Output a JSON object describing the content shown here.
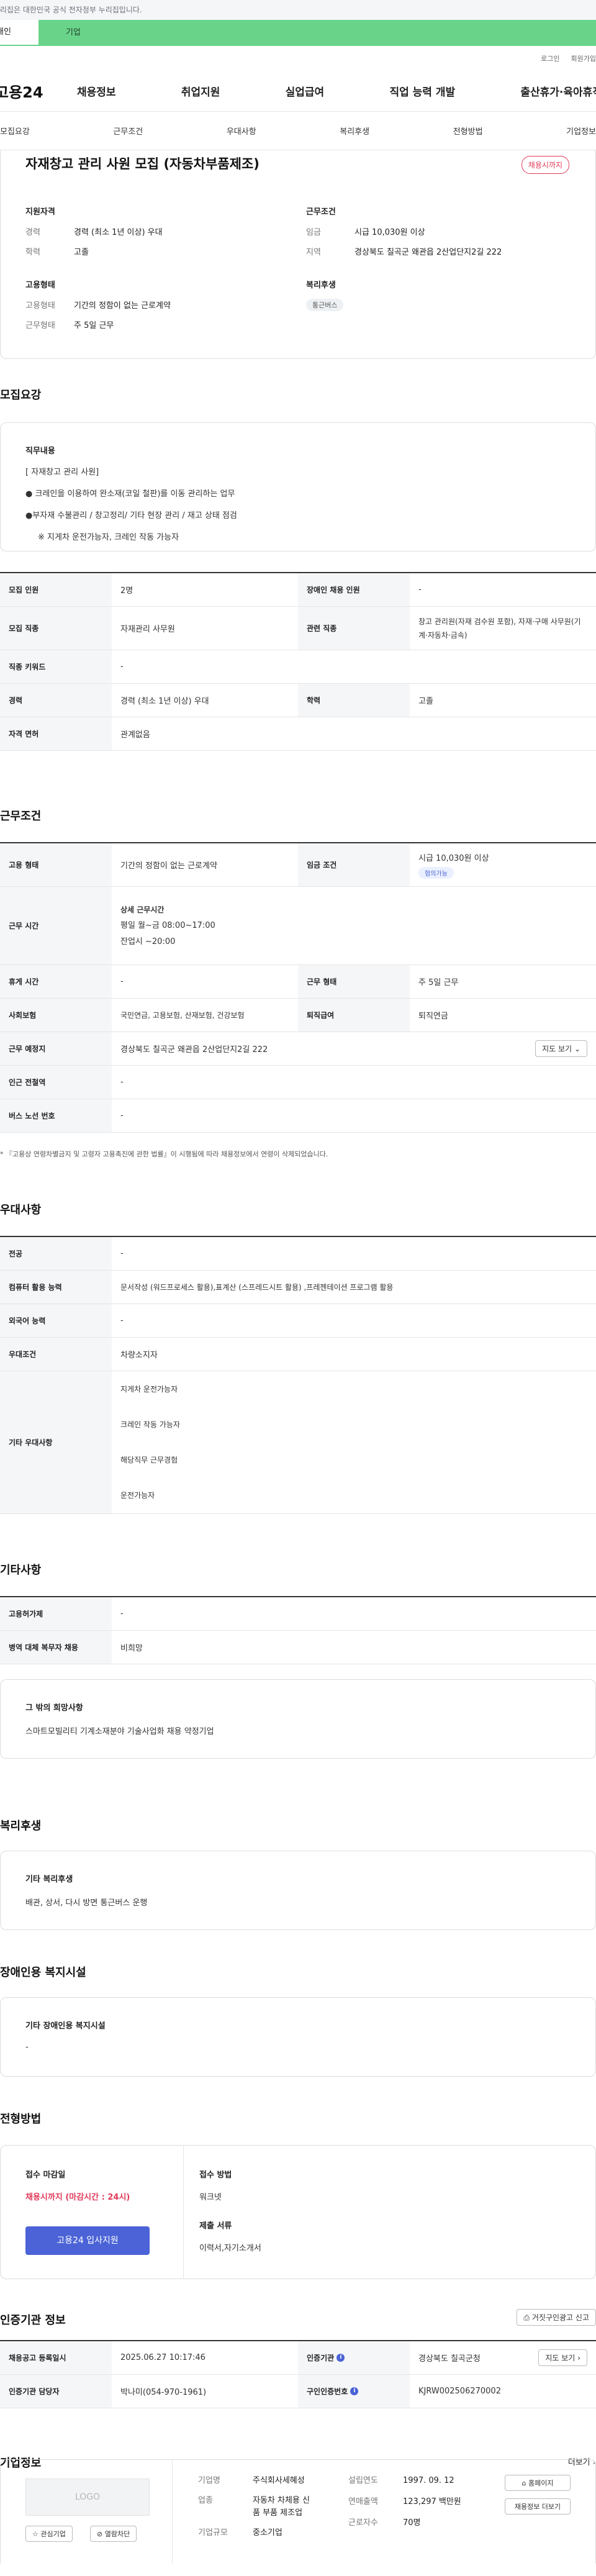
{
  "gov_banner": "이 누리집은 대한민국 공식 전자정부 누리집입니다.",
  "tabs": [
    "개인",
    "기업"
  ],
  "util": [
    "로그인",
    "회원가입"
  ],
  "logo": "고용24",
  "gnb": [
    "채용정보",
    "취업지원",
    "실업급여",
    "직업 능력 개발",
    "출산휴가·육아휴직"
  ],
  "anchors": [
    "모집요강",
    "근무조건",
    "우대사항",
    "복리후생",
    "전형방법",
    "기업정보"
  ],
  "summary": {
    "title": "자재창고 관리 사원 모집 (자동차부품제조)",
    "status": "채용시까지",
    "qual_h": "지원자격",
    "career_k": "경력",
    "career_v": "경력 (최소 1년 이상) 우대",
    "edu_k": "학력",
    "edu_v": "고졸",
    "cond_h": "근무조건",
    "wage_k": "임금",
    "wage_v": "시급 10,030원 이상",
    "area_k": "지역",
    "area_v": "경상북도 칠곡군 왜관읍 2산업단지2길 222",
    "emp_h": "고용형태",
    "etype_k": "고용형태",
    "etype_v": "기간의 정함이 없는 근로계약",
    "wtype_k": "근무형태",
    "wtype_v": "주 5일 근무",
    "welfare_h": "복리후생",
    "welfare_badge": "통근버스"
  },
  "recruit": {
    "heading": "모집요강",
    "duty_h": "직무내용",
    "duty_lines": [
      "[ 자재창고 관리 사원]",
      "● 크레인을 이용하여 완소재(코일 철판)를 이동 관리하는 업무",
      "●부자재 수불관리 / 창고정리/ 기타 현장 관리 / 재고 상태 점검",
      "※ 지게차 운전가능자,  크레인 작동 가능자"
    ],
    "rows": [
      {
        "k1": "모집 인원",
        "v1": "2명",
        "k2": "장애인 채용 인원",
        "v2": "-"
      },
      {
        "k1": "모집 직종",
        "v1": "자재관리 사무원",
        "k2": "관련 직종",
        "v2": "창고 관리원(자재 검수원 포함), 자재·구매 사무원(기계·자동차·금속)"
      },
      {
        "k1": "직종 키워드",
        "v1": "-"
      },
      {
        "k1": "경력",
        "v1": "경력 (최소 1년 이상) 우대",
        "k2": "학력",
        "v2": "고졸"
      },
      {
        "k1": "자격 면허",
        "v1": "관계없음"
      }
    ]
  },
  "work": {
    "heading": "근무조건",
    "etype_k": "고용 형태",
    "etype_v": "기간의 정함이 없는 근로계약",
    "wage_k": "임금 조건",
    "wage_v": "시급 10,030원 이상",
    "wage_badge": "협의가능",
    "time_k": "근무 시간",
    "time_h": "상세 근무시간",
    "time_1": "평일 월~금 08:00~17:00",
    "time_2": "잔업시 ~20:00",
    "rest_k": "휴게 시간",
    "rest_v": "-",
    "wtype_k": "근무 형태",
    "wtype_v": "주 5일 근무",
    "ins_k": "사회보험",
    "ins_v": "국민연금, 고용보험, 산재보험, 건강보험",
    "ret_k": "퇴직급여",
    "ret_v": "퇴직연금",
    "place_k": "근무 예정지",
    "place_v": "경상북도 칠곡군 왜관읍 2산업단지2길 222",
    "map_btn": "지도 보기",
    "sub_k": "인근 전철역",
    "sub_v": "-",
    "bus_k": "버스 노선 번호",
    "bus_v": "-",
    "note": "* 『고용상 연령차별금지 및 고령자 고용촉진에 관한 법률』이 시행됨에 따라 채용정보에서 연령이 삭제되었습니다."
  },
  "pref": {
    "heading": "우대사항",
    "major_k": "전공",
    "major_v": "-",
    "pc_k": "컴퓨터 활용 능력",
    "pc_v": "문서작성 (워드프로세스 활용),표계산 (스프레드시트 활용) ,프레젠테이션 프로그램 활용",
    "lang_k": "외국어 능력",
    "lang_v": "-",
    "cond_k": "우대조건",
    "cond_v": "차량소지자",
    "etc_k": "기타 우대사항",
    "etc_v": [
      "지게차 운전가능자",
      "크레인 작동 가능자",
      "해당직무 근무경험",
      "운전가능자"
    ]
  },
  "other": {
    "heading": "기타사항",
    "permit_k": "고용허가제",
    "permit_v": "-",
    "mil_k": "병역 대체 복무자 채용",
    "mil_v": "비희망",
    "hope_h": "그 밖의 희망사항",
    "hope_v": "스마트모빌리티 기계소재분야 기술사업화 채용 약정기업"
  },
  "welfare": {
    "heading": "복리후생",
    "h": "기타 복리후생",
    "v": "배관, 상서, 다시 방면 통근버스 운행"
  },
  "disab": {
    "heading": "장애인용 복지시설",
    "h": "기타 장애인용 복지시설",
    "v": "-"
  },
  "process": {
    "heading": "전형방법",
    "deadline_h": "접수 마감일",
    "deadline_v": "채용시까지 (마감시간 : 24시)",
    "apply_btn": "고용24 입사지원",
    "method_h": "접수 방법",
    "method_v": "워크넷",
    "docs_h": "제출 서류",
    "docs_v": "이력서,자기소개서"
  },
  "cert": {
    "heading": "인증기관 정보",
    "report_btn": "거짓구인광고 신고",
    "reg_k": "채용공고 등록일시",
    "reg_v": "2025.06.27 10:17:46",
    "inst_k": "인증기관",
    "inst_v": "경상북도 칠곡군청",
    "map_btn": "지도 보기",
    "mgr_k": "인증기관 담당자",
    "mgr_v": "박나미(054-970-1961)",
    "num_k": "구인인증번호",
    "num_v": "KJRW002506270002"
  },
  "company": {
    "heading": "기업정보",
    "more": "더보기",
    "logo": "LOGO",
    "fav_btn": "관심기업",
    "follow_btn": "열람차단",
    "name_k": "기업명",
    "name_v": "주식회사세혜성",
    "ind_k": "업종",
    "ind_v": "자동차 차체용 신품 부품 제조업",
    "size_k": "기업규모",
    "size_v": "중소기업",
    "year_k": "설립연도",
    "year_v": "1997. 09. 12",
    "sales_k": "연매출액",
    "sales_v": "123,297 백만원",
    "emp_k": "근로자수",
    "emp_v": "70명",
    "home_btn": "홈페이지",
    "list_btn": "채용정보 더보기"
  }
}
